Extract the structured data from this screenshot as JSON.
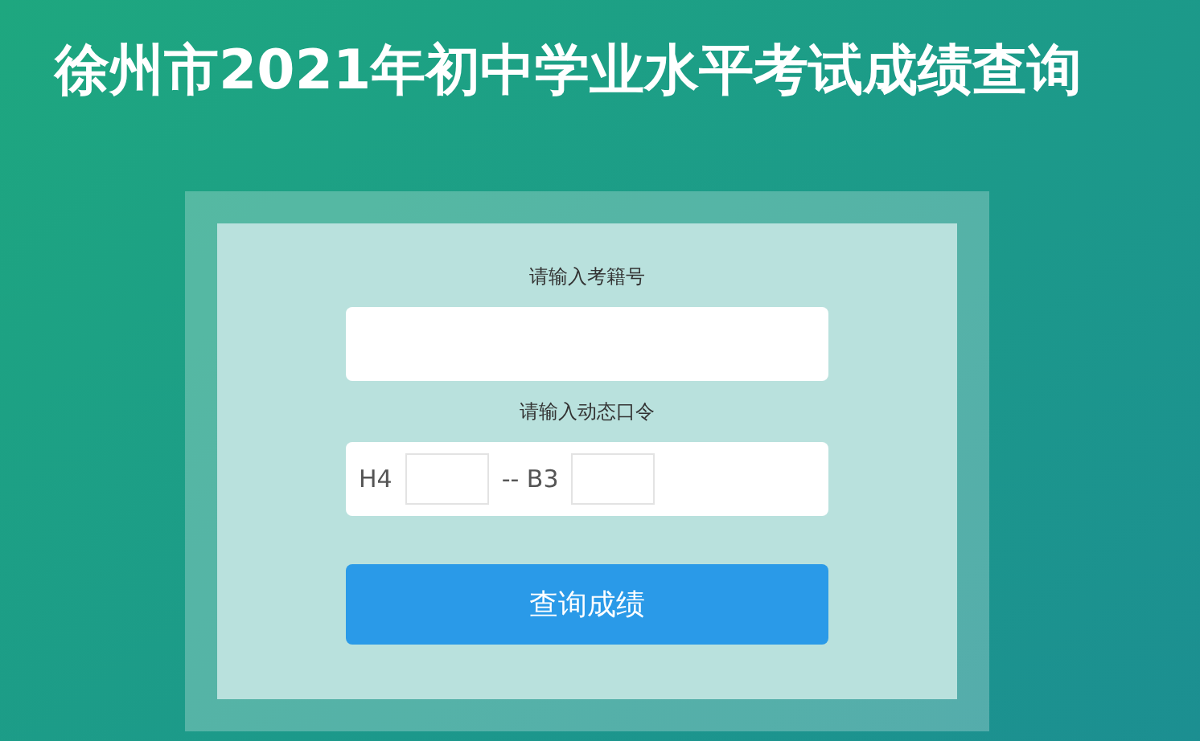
{
  "title": "徐州市2021年初中学业水平考试成绩查询",
  "form": {
    "id_label": "请输入考籍号",
    "code_label": "请输入动态口令",
    "code_parts": [
      {
        "prefix": "H4"
      },
      {
        "prefix": "-- B3"
      }
    ],
    "submit": "查询成绩"
  }
}
